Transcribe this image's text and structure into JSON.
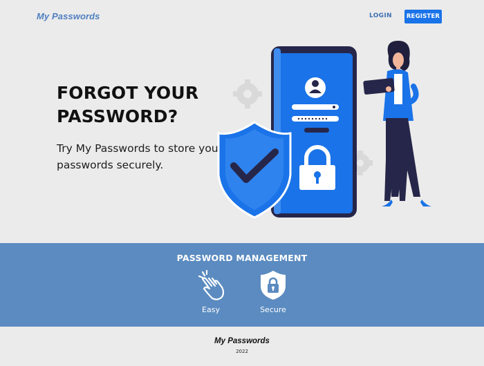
{
  "nav": {
    "brand": "My Passwords",
    "login_label": "LOGIN",
    "register_label": "REGISTER"
  },
  "hero": {
    "title": "FORGOT YOUR PASSWORD?",
    "subtitle": "Try My Passwords to store your passwords securely."
  },
  "illustration": {
    "icons": [
      "gear-icon",
      "shield-check-icon",
      "phone-icon",
      "user-avatar-icon",
      "password-field-icon",
      "padlock-icon",
      "woman-with-tablet"
    ],
    "colors": {
      "primary": "#1a73e8",
      "dark": "#26264a",
      "gear": "#d8d8d8"
    }
  },
  "features": {
    "title": "PASSWORD MANAGEMENT",
    "items": [
      {
        "label": "Easy",
        "icon": "hand-tap-icon"
      },
      {
        "label": "Secure",
        "icon": "shield-lock-icon"
      }
    ],
    "background": "#5b8bc0"
  },
  "footer": {
    "brand": "My Passwords",
    "year": "2022"
  }
}
